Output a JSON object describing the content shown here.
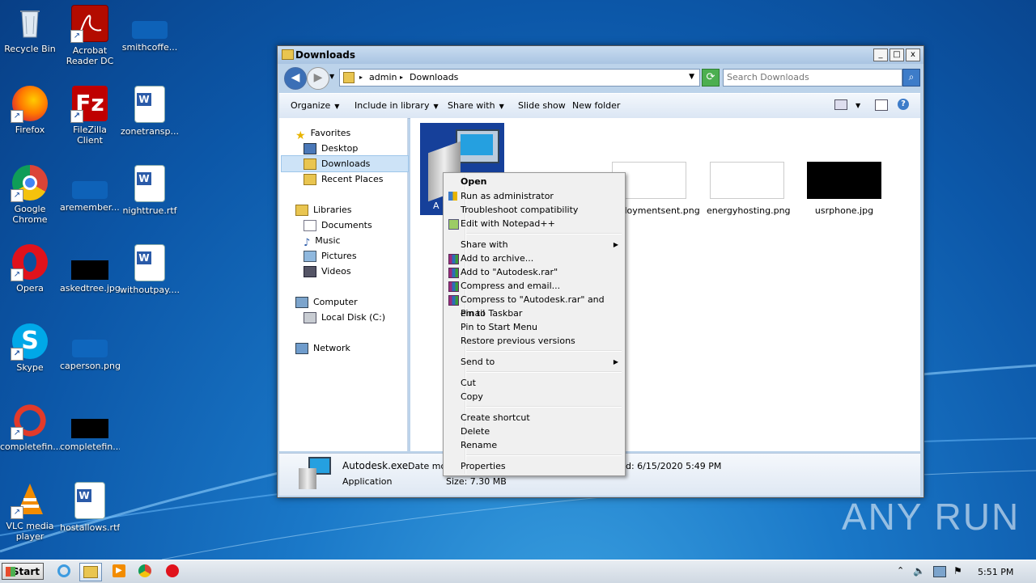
{
  "colors": {
    "accent": "#3d7cc9",
    "selection": "#cde3f7",
    "desktop": "#0c57a8"
  },
  "desktop_icons": [
    {
      "label": "Recycle Bin",
      "icon": "recycle-bin-icon"
    },
    {
      "label": "Acrobat Reader DC",
      "icon": "acrobat-icon"
    },
    {
      "label": "smithcoffe...",
      "icon": "file-icon"
    },
    {
      "label": "Firefox",
      "icon": "firefox-icon"
    },
    {
      "label": "FileZilla Client",
      "icon": "filezilla-icon"
    },
    {
      "label": "zonetransp...",
      "icon": "word-doc-icon"
    },
    {
      "label": "Google Chrome",
      "icon": "chrome-icon"
    },
    {
      "label": "aremember....",
      "icon": "file-icon"
    },
    {
      "label": "nighttrue.rtf",
      "icon": "word-doc-icon"
    },
    {
      "label": "Opera",
      "icon": "opera-icon"
    },
    {
      "label": "askedtree.jpg",
      "icon": "image-icon"
    },
    {
      "label": "withoutpay....",
      "icon": "word-doc-icon"
    },
    {
      "label": "Skype",
      "icon": "skype-icon"
    },
    {
      "label": "caperson.png",
      "icon": "image-icon"
    },
    {
      "label": "CCleaner",
      "icon": "ccleaner-icon"
    },
    {
      "label": "completefin....",
      "icon": "image-icon"
    },
    {
      "label": "VLC media player",
      "icon": "vlc-icon"
    },
    {
      "label": "hostallows.rtf",
      "icon": "word-doc-icon"
    }
  ],
  "window": {
    "title": "Downloads",
    "controls": {
      "minimize": "_",
      "maximize": "□",
      "close": "x"
    },
    "breadcrumb": [
      "admin",
      "Downloads"
    ],
    "search_placeholder": "Search Downloads",
    "toolbar": {
      "organize": "Organize",
      "include": "Include in library",
      "share": "Share with",
      "slideshow": "Slide show",
      "newfolder": "New folder"
    },
    "nav": {
      "favorites": "Favorites",
      "desktop": "Desktop",
      "downloads": "Downloads",
      "recent": "Recent Places",
      "libraries": "Libraries",
      "documents": "Documents",
      "music": "Music",
      "pictures": "Pictures",
      "videos": "Videos",
      "computer": "Computer",
      "localdisk": "Local Disk (C:)",
      "network": "Network"
    },
    "files": [
      {
        "name": "A",
        "type": "installer"
      },
      {
        "name": "employmentsent.png",
        "type": "image"
      },
      {
        "name": "energyhosting.png",
        "type": "image"
      },
      {
        "name": "usrphone.jpg",
        "type": "image-dark"
      }
    ],
    "details": {
      "name": "Autodesk.exe",
      "date_label": "Date mod",
      "type": "Application",
      "size": "Size: 7.30 MB",
      "modified": "d: 6/15/2020 5:49 PM"
    }
  },
  "context_menu": {
    "open": "Open",
    "runadmin": "Run as administrator",
    "troubleshoot": "Troubleshoot compatibility",
    "notepad": "Edit with Notepad++",
    "sharewith": "Share with",
    "addarchive": "Add to archive...",
    "addrar": "Add to \"Autodesk.rar\"",
    "compressemail": "Compress and email...",
    "compressrar": "Compress to \"Autodesk.rar\" and email",
    "pintaskbar": "Pin to Taskbar",
    "pinstart": "Pin to Start Menu",
    "restore": "Restore previous versions",
    "sendto": "Send to",
    "cut": "Cut",
    "copy": "Copy",
    "shortcut": "Create shortcut",
    "delete": "Delete",
    "rename": "Rename",
    "properties": "Properties"
  },
  "taskbar": {
    "start": "Start",
    "clock": "5:51 PM"
  },
  "watermark": "ANY RUN"
}
